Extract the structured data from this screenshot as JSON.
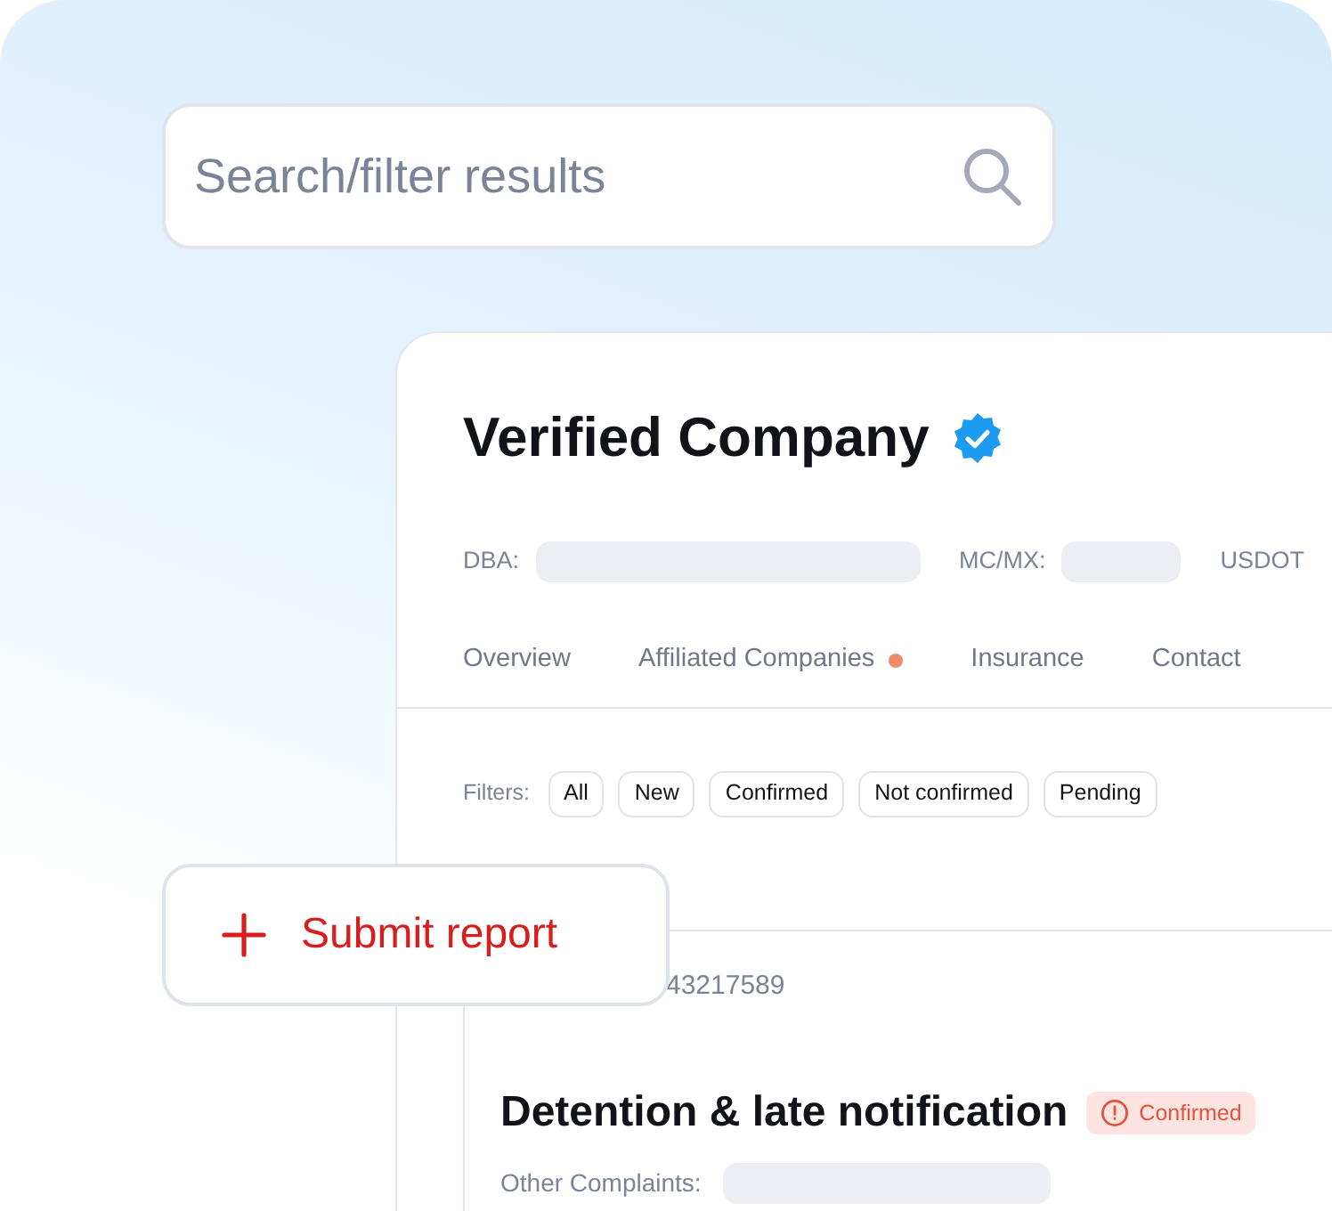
{
  "search": {
    "placeholder": "Search/filter results"
  },
  "company": {
    "name": "Verified Company",
    "verified": true,
    "fields": [
      {
        "label": "DBA:",
        "kind": "redacted"
      },
      {
        "label": "MC/MX:",
        "kind": "redacted"
      },
      {
        "label": "USDOT",
        "kind": "label"
      }
    ],
    "tabs": [
      {
        "label": "Overview",
        "dot": false
      },
      {
        "label": "Affiliated Companies",
        "dot": true
      },
      {
        "label": "Insurance",
        "dot": false
      },
      {
        "label": "Contact",
        "dot": false
      }
    ],
    "filters_label": "Filters:",
    "filters": [
      "All",
      "New",
      "Confirmed",
      "Not confirmed",
      "Pending"
    ],
    "report": {
      "number": "43217589",
      "title": "Detention & late notification",
      "status": {
        "label": "Confirmed",
        "kind": "warning"
      },
      "other_label": "Other Complaints:"
    }
  },
  "submit_button": {
    "label": "Submit report"
  }
}
